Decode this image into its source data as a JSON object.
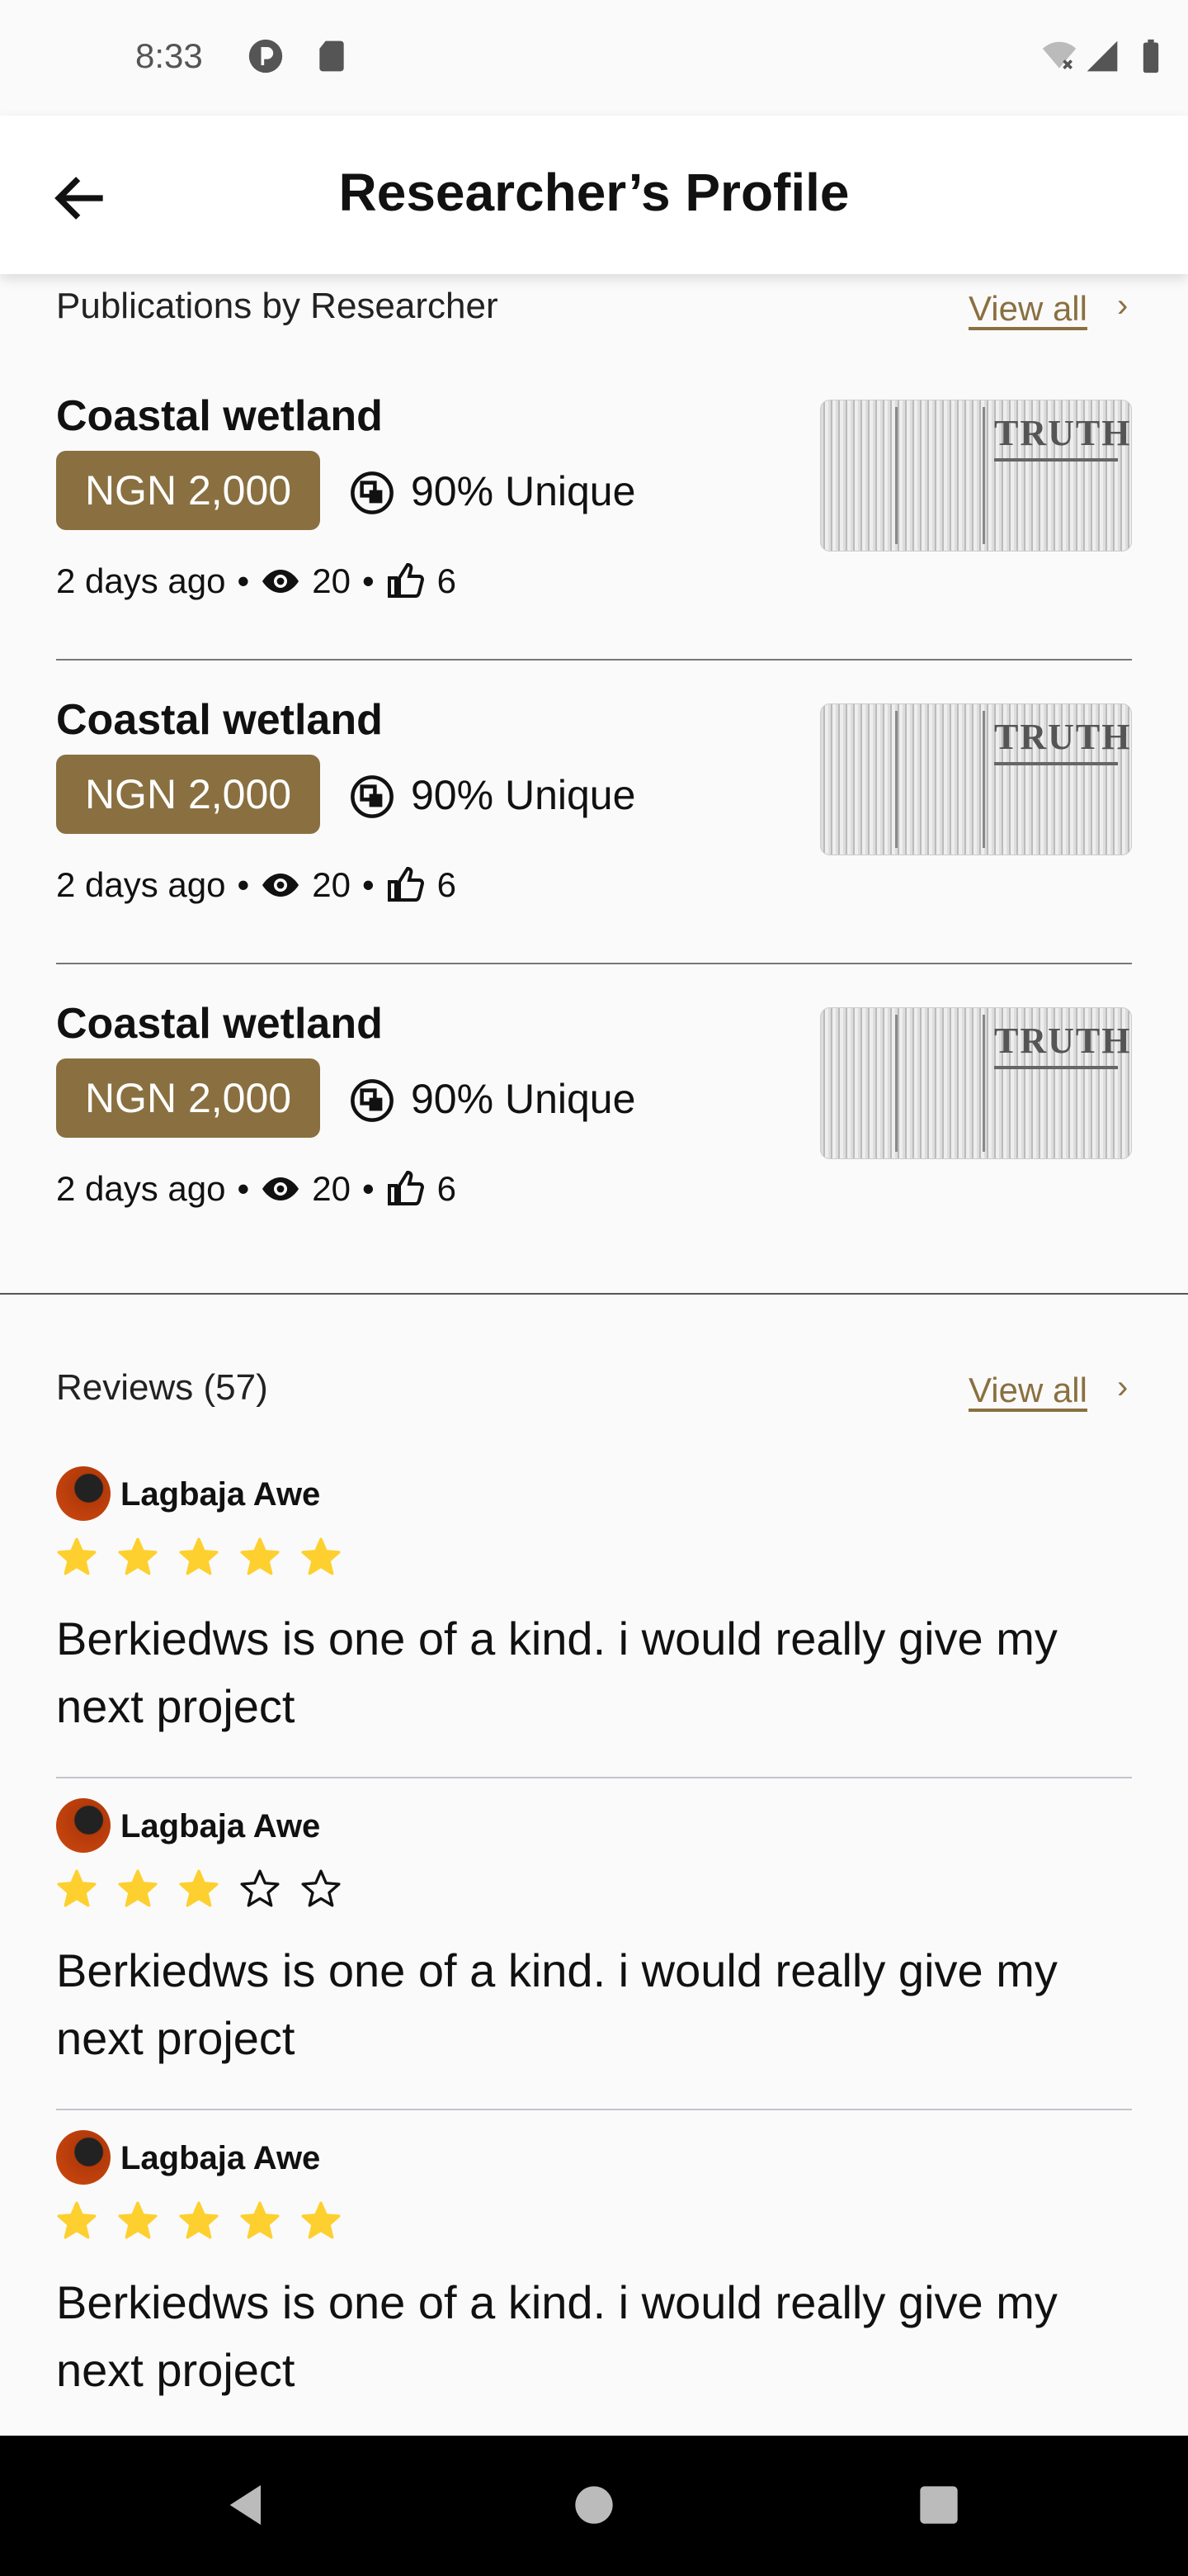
{
  "status_bar": {
    "time": "8:33"
  },
  "app_bar": {
    "title": "Researcher’s Profile"
  },
  "publications": {
    "heading": "Publications by Researcher",
    "view_all": "View all",
    "items": [
      {
        "title": "Coastal wetland",
        "price": "NGN 2,000",
        "unique": "90% Unique",
        "age": "2 days ago",
        "views": "20",
        "likes": "6",
        "thumb_text": "TRUTH"
      },
      {
        "title": "Coastal wetland",
        "price": "NGN 2,000",
        "unique": "90% Unique",
        "age": "2 days ago",
        "views": "20",
        "likes": "6",
        "thumb_text": "TRUTH"
      },
      {
        "title": "Coastal wetland",
        "price": "NGN 2,000",
        "unique": "90% Unique",
        "age": "2 days ago",
        "views": "20",
        "likes": "6",
        "thumb_text": "TRUTH"
      }
    ]
  },
  "reviews": {
    "heading": "Reviews (57)",
    "view_all": "View all",
    "items": [
      {
        "name": "Lagbaja Awe",
        "rating": 5,
        "text": "Berkiedws is one of a kind. i would really give my next project"
      },
      {
        "name": "Lagbaja Awe",
        "rating": 3,
        "text": "Berkiedws is one of a kind. i would really give my next project"
      },
      {
        "name": "Lagbaja Awe",
        "rating": 5,
        "text": "Berkiedws is one of a kind. i would really give my next project"
      }
    ]
  },
  "colors": {
    "accent": "#8a7040",
    "star": "#fdd02f"
  }
}
